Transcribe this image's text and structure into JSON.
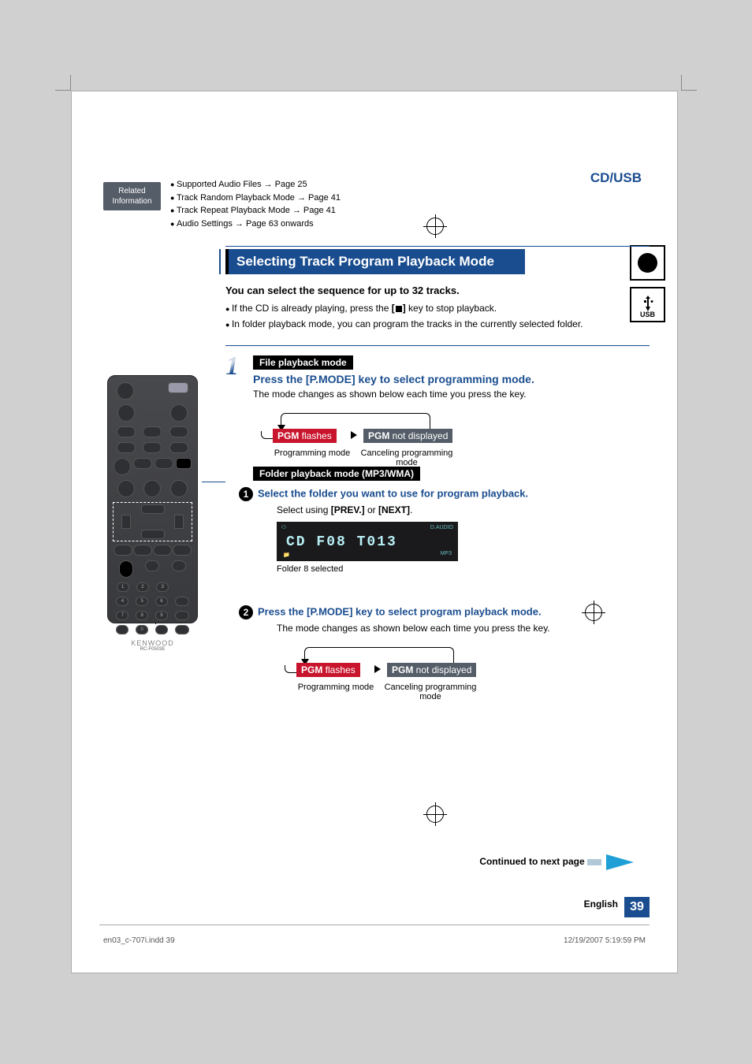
{
  "header": {
    "section": "CD/USB"
  },
  "related": {
    "label_line1": "Related",
    "label_line2": "Information",
    "items": [
      "Supported Audio Files → Page 25",
      "Track Random Playback Mode → Page 41",
      "Track Repeat Playback Mode → Page 41",
      "Audio Settings → Page 63 onwards"
    ]
  },
  "side_icons": {
    "usb_label": "USB"
  },
  "title": "Selecting Track Program Playback Mode",
  "intro": {
    "bold": "You can select the sequence for up to 32 tracks.",
    "bullets": [
      "If the CD is already playing, press the [■] key to stop playback.",
      "In folder playback mode, you can program the tracks in the currently selected folder."
    ]
  },
  "step1": {
    "num": "1",
    "mode_label": "File playback mode",
    "heading": "Press the [P.MODE] key to select programming mode.",
    "body": "The mode changes as shown below each time you press the key.",
    "pgm_a_bold": "PGM",
    "pgm_a_rest": " flashes",
    "pgm_b_bold": "PGM",
    "pgm_b_rest": " not displayed",
    "cap_a": "Programming mode",
    "cap_b": "Canceling programming mode"
  },
  "folder": {
    "mode_label": "Folder playback mode (MP3/WMA)",
    "sub1": {
      "num": "1",
      "heading": "Select the folder you want to use for program playback.",
      "body_pre": "Select using ",
      "body_b1": "[PREV.]",
      "body_mid": " or ",
      "body_b2": "[NEXT]",
      "body_end": ".",
      "lcd_main": "CD   F08 T013",
      "lcd_caption": "Folder 8 selected"
    },
    "sub2": {
      "num": "2",
      "heading": "Press the [P.MODE] key to select program playback mode.",
      "body": "The mode changes as shown below each time you press the key.",
      "pgm_a_bold": "PGM",
      "pgm_a_rest": " flashes",
      "pgm_b_bold": "PGM",
      "pgm_b_rest": " not displayed",
      "cap_a": "Programming mode",
      "cap_b": "Canceling programming mode"
    }
  },
  "remote": {
    "brand": "KENWOOD",
    "model": "RC-F0503E"
  },
  "continued": "Continued to next page",
  "footer": {
    "lang": "English",
    "page": "39",
    "print_l": "en03_c-707i.indd   39",
    "print_r": "12/19/2007   5:19:59 PM"
  }
}
